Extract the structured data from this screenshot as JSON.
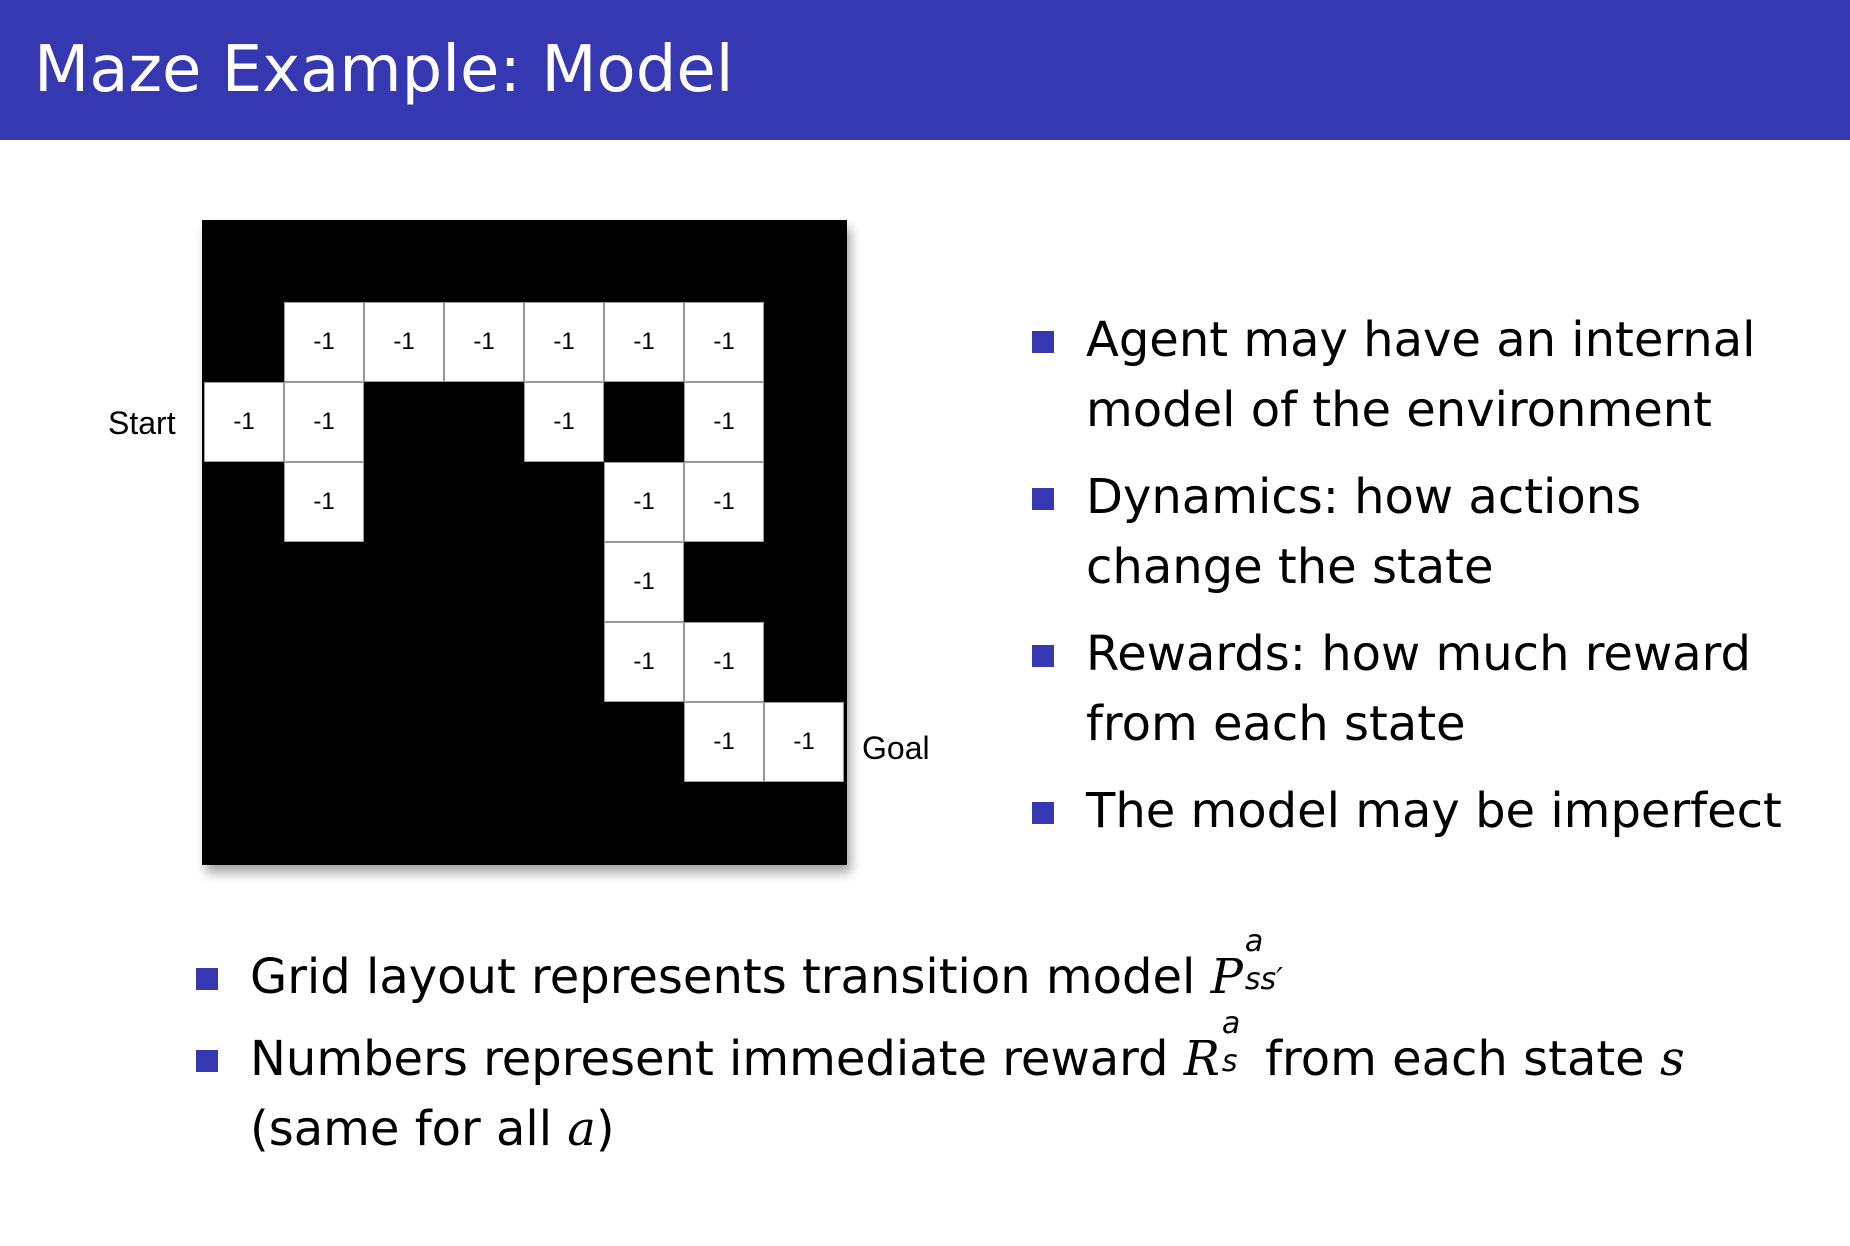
{
  "slide": {
    "title": "Maze Example:  Model",
    "accent_color": "#3538b0"
  },
  "maze": {
    "grid_size": 8,
    "start_label": "Start",
    "goal_label": "Goal",
    "cells": [
      {
        "row": 1,
        "col": 1,
        "reward": "-1"
      },
      {
        "row": 1,
        "col": 2,
        "reward": "-1"
      },
      {
        "row": 1,
        "col": 3,
        "reward": "-1"
      },
      {
        "row": 1,
        "col": 4,
        "reward": "-1"
      },
      {
        "row": 1,
        "col": 5,
        "reward": "-1"
      },
      {
        "row": 1,
        "col": 6,
        "reward": "-1"
      },
      {
        "row": 2,
        "col": 0,
        "reward": "-1"
      },
      {
        "row": 2,
        "col": 1,
        "reward": "-1"
      },
      {
        "row": 2,
        "col": 4,
        "reward": "-1"
      },
      {
        "row": 2,
        "col": 6,
        "reward": "-1"
      },
      {
        "row": 3,
        "col": 1,
        "reward": "-1"
      },
      {
        "row": 3,
        "col": 5,
        "reward": "-1"
      },
      {
        "row": 3,
        "col": 6,
        "reward": "-1"
      },
      {
        "row": 4,
        "col": 5,
        "reward": "-1"
      },
      {
        "row": 5,
        "col": 5,
        "reward": "-1"
      },
      {
        "row": 5,
        "col": 6,
        "reward": "-1"
      },
      {
        "row": 6,
        "col": 6,
        "reward": "-1"
      },
      {
        "row": 6,
        "col": 7,
        "reward": "-1"
      }
    ]
  },
  "right_bullets": [
    {
      "line1": "Agent may have an internal",
      "line2": "model of the environment"
    },
    {
      "line1": "Dynamics:  how actions",
      "line2": "change the state"
    },
    {
      "line1": "Rewards:  how much reward",
      "line2": "from each state"
    },
    {
      "line1": "The model may be imperfect",
      "line2": ""
    }
  ],
  "bottom_bullets": {
    "b1_text": "Grid layout represents transition model ",
    "b1_symbol": "P",
    "b1_sup": "a",
    "b1_sub": "ss′",
    "b2_text_a": "Numbers represent immediate reward ",
    "b2_symbol": "R",
    "b2_sup": "a",
    "b2_sub": "s",
    "b2_text_b": " from each state ",
    "b2_var_s": "s",
    "b2_line2_a": "(same for all ",
    "b2_var_a": "a",
    "b2_line2_b": ")"
  }
}
